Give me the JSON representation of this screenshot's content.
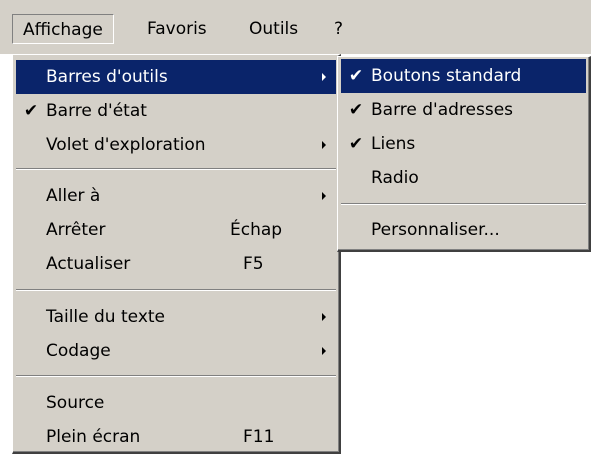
{
  "menubar": {
    "items": [
      "Affichage",
      "Favoris",
      "Outils",
      "?"
    ]
  },
  "view_menu": {
    "items": [
      {
        "label": "Barres d'outils",
        "check": "",
        "shortcut": "",
        "submenu": true
      },
      {
        "label": "Barre d'état",
        "check": "✔",
        "shortcut": "",
        "submenu": false
      },
      {
        "label": "Volet d'exploration",
        "check": "",
        "shortcut": "",
        "submenu": true
      },
      {
        "label": "Aller à",
        "check": "",
        "shortcut": "",
        "submenu": true
      },
      {
        "label": "Arrêter",
        "check": "",
        "shortcut": "Échap",
        "submenu": false
      },
      {
        "label": "Actualiser",
        "check": "",
        "shortcut": "F5",
        "submenu": false
      },
      {
        "label": "Taille du texte",
        "check": "",
        "shortcut": "",
        "submenu": true
      },
      {
        "label": "Codage",
        "check": "",
        "shortcut": "",
        "submenu": true
      },
      {
        "label": "Source",
        "check": "",
        "shortcut": "",
        "submenu": false
      },
      {
        "label": "Plein écran",
        "check": "",
        "shortcut": "F11",
        "submenu": false
      }
    ]
  },
  "toolbars_submenu": {
    "items": [
      {
        "label": "Boutons standard",
        "check": "✔"
      },
      {
        "label": "Barre d'adresses",
        "check": "✔"
      },
      {
        "label": "Liens",
        "check": "✔"
      },
      {
        "label": "Radio",
        "check": ""
      },
      {
        "label": "Personnaliser...",
        "check": ""
      }
    ]
  },
  "colors": {
    "menu_face": "#d4d0c8",
    "highlight": "#0a246a",
    "highlight_text": "#ffffff"
  },
  "icons": {
    "check": "checkmark-icon",
    "submenu": "submenu-arrow-icon"
  }
}
